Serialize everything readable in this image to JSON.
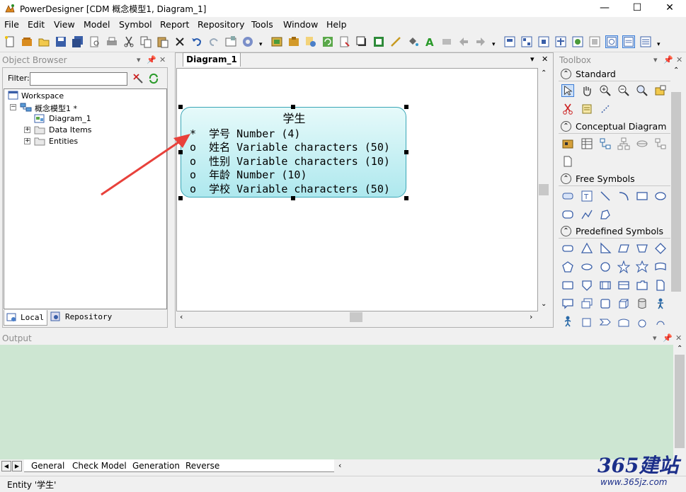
{
  "window": {
    "title": "PowerDesigner [CDM 概念模型1, Diagram_1]",
    "controls": [
      "—",
      "☐",
      "✕"
    ]
  },
  "menu": [
    "File",
    "Edit",
    "View",
    "Model",
    "Symbol",
    "Report",
    "Repository",
    "Tools",
    "Window",
    "Help"
  ],
  "object_browser": {
    "header": "Object Browser",
    "filter_label": "Filter:",
    "filter_value": "",
    "tree": {
      "workspace": "Workspace",
      "model": "概念模型1 *",
      "diagram": "Diagram_1",
      "data_items": "Data Items",
      "entities": "Entities"
    },
    "tabs": [
      "Local",
      "Repository"
    ]
  },
  "diagram": {
    "tab": "Diagram_1",
    "entity": {
      "name": "学生",
      "rows": [
        {
          "marker": "*",
          "name": "学号",
          "type": "Number (4)"
        },
        {
          "marker": "o",
          "name": "姓名",
          "type": "Variable characters (50)"
        },
        {
          "marker": "o",
          "name": "性别",
          "type": "Variable characters (10)"
        },
        {
          "marker": "o",
          "name": "年龄",
          "type": "Number (10)"
        },
        {
          "marker": "o",
          "name": "学校",
          "type": "Variable characters (50)"
        }
      ]
    }
  },
  "toolbox": {
    "header": "Toolbox",
    "sections": [
      "Standard",
      "Conceptual Diagram",
      "Free Symbols",
      "Predefined Symbols"
    ]
  },
  "output": {
    "header": "Output",
    "tabs": [
      "General",
      "Check Model",
      "Generation",
      "Reverse"
    ]
  },
  "status": "Entity '学生'",
  "watermark": {
    "brand": "365建站",
    "url": "www.365jz.com"
  },
  "colors": {
    "entity_fill": "#aee8ee",
    "entity_border": "#3aa6b6",
    "output_bg": "#cde6d2",
    "arrow": "#e8413b"
  }
}
